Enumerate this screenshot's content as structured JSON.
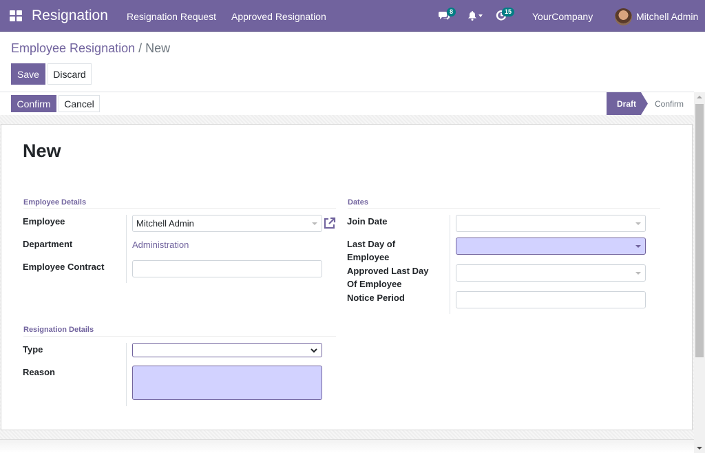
{
  "navbar": {
    "app_name": "Resignation",
    "menu": [
      "Resignation Request",
      "Approved Resignation"
    ],
    "messages_count": "8",
    "activities_count": "15",
    "company": "YourCompany",
    "user": "Mitchell Admin",
    "icons": [
      "apps-icon",
      "chat-icon",
      "bell-icon",
      "clock-icon"
    ]
  },
  "breadcrumb": {
    "parent": "Employee Resignation",
    "separator": "/",
    "current": "New"
  },
  "buttons": {
    "save": "Save",
    "discard": "Discard",
    "confirm": "Confirm",
    "cancel": "Cancel"
  },
  "statusbar": {
    "stages": [
      "Draft",
      "Confirm"
    ],
    "active_stage": "Draft"
  },
  "form": {
    "title": "New",
    "employee_details": {
      "heading": "Employee Details",
      "employee_label": "Employee",
      "employee_value": "Mitchell Admin",
      "department_label": "Department",
      "department_value": "Administration",
      "contract_label": "Employee Contract",
      "contract_value": ""
    },
    "dates": {
      "heading": "Dates",
      "join_date_label": "Join Date",
      "join_date_value": "",
      "last_day_label_1": "Last Day of",
      "last_day_label_2": "Employee",
      "last_day_value": "",
      "approved_label_1": "Approved Last Day",
      "approved_label_2": "Of Employee",
      "approved_value": "",
      "notice_label": "Notice Period",
      "notice_value": ""
    },
    "resignation_details": {
      "heading": "Resignation Details",
      "type_label": "Type",
      "type_value": "",
      "reason_label": "Reason",
      "reason_value": ""
    }
  },
  "colors": {
    "brand": "#71639e",
    "badge": "#017e84",
    "required_field": "#d2d2ff"
  }
}
